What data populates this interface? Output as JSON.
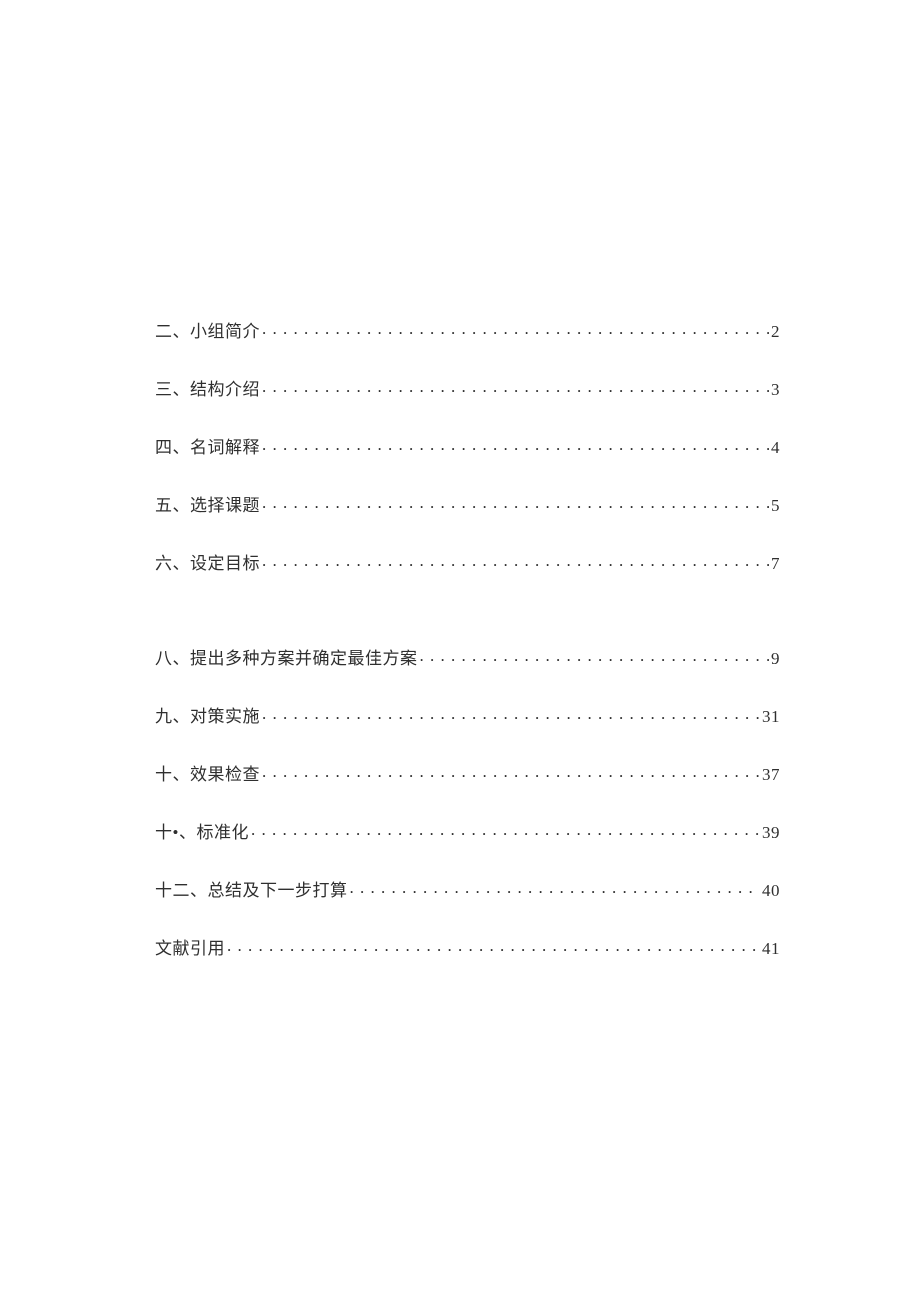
{
  "toc": {
    "groups": [
      {
        "entries": [
          {
            "title": "二、小组简介",
            "page": "2"
          },
          {
            "title": "三、结构介绍",
            "page": "3"
          },
          {
            "title": "四、名词解释",
            "page": "4"
          },
          {
            "title": "五、选择课题",
            "page": "5"
          },
          {
            "title": "六、设定目标",
            "page": "7"
          }
        ]
      },
      {
        "entries": [
          {
            "title": "八、提出多种方案并确定最佳方案",
            "page": "9"
          },
          {
            "title": "九、对策实施",
            "page": "31"
          },
          {
            "title": "十、效果检查",
            "page": "37"
          },
          {
            "title": "十•、标准化",
            "page": "39"
          },
          {
            "title": "十二、总结及下一步打算",
            "page": "40"
          },
          {
            "title": "文献引用",
            "page": "41"
          }
        ]
      }
    ]
  }
}
